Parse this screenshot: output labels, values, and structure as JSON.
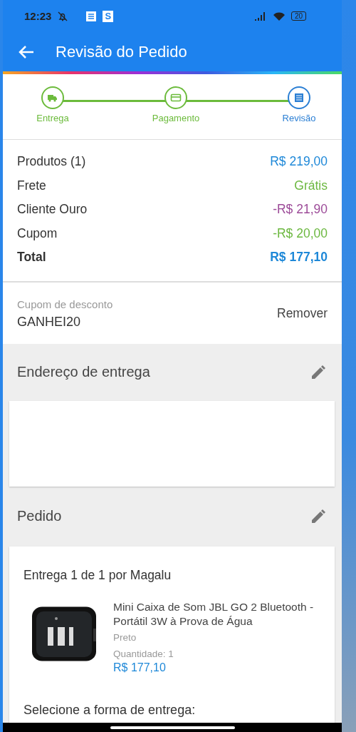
{
  "status_bar": {
    "time": "12:23",
    "app_badge": "S",
    "battery": "20"
  },
  "app_bar": {
    "title": "Revisão do Pedido"
  },
  "steps": [
    {
      "label": "Entrega",
      "selected": false
    },
    {
      "label": "Pagamento",
      "selected": false
    },
    {
      "label": "Revisão",
      "selected": true
    }
  ],
  "summary": [
    {
      "label": "Produtos (1)",
      "value": "R$ 219,00",
      "color": "#1e88d8",
      "kind": "line"
    },
    {
      "label": "Frete",
      "value": "Grátis",
      "color": "#6cb840",
      "kind": "line"
    },
    {
      "label": "Cliente Ouro",
      "value": "-R$ 21,90",
      "color": "#9c4a98",
      "kind": "line"
    },
    {
      "label": "Cupom",
      "value": "-R$ 20,00",
      "color": "#6cb840",
      "kind": "line"
    },
    {
      "label": "Total",
      "value": "R$ 177,10",
      "color": "#1e88d8",
      "kind": "total"
    }
  ],
  "coupon": {
    "label": "Cupom de desconto",
    "code": "GANHEI20",
    "action": "Remover"
  },
  "address": {
    "title": "Endereço de entrega"
  },
  "order": {
    "title": "Pedido",
    "shipment": "Entrega 1 de 1 por Magalu",
    "product": {
      "kind": "picture",
      "name": "Mini Caixa de Som JBL GO 2 Bluetooth - Portátil 3W à Prova de Água",
      "variant": "Preto",
      "quantity_label": "Quantidade:",
      "quantity": "1",
      "price": "R$ 177,10"
    },
    "delivery_prompt": "Selecione a forma de entrega:"
  }
}
